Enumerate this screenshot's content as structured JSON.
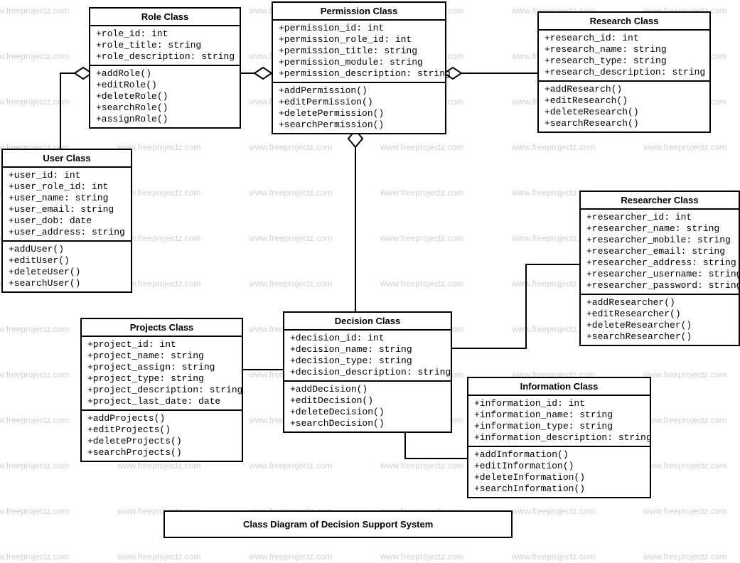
{
  "diagram_title": "Class Diagram of Decision Support System",
  "watermark_text": "www.freeprojectz.com",
  "classes": {
    "role": {
      "name": "Role Class",
      "attrs": [
        "+role_id: int",
        "+role_title: string",
        "+role_description: string"
      ],
      "ops": [
        "+addRole()",
        "+editRole()",
        "+deleteRole()",
        "+searchRole()",
        "+assignRole()"
      ]
    },
    "permission": {
      "name": "Permission Class",
      "attrs": [
        "+permission_id: int",
        "+permission_role_id: int",
        "+permission_title: string",
        "+permission_module: string",
        "+permission_description: string"
      ],
      "ops": [
        "+addPermission()",
        "+editPermission()",
        "+deletePermission()",
        "+searchPermission()"
      ]
    },
    "research": {
      "name": "Research Class",
      "attrs": [
        "+research_id: int",
        "+research_name: string",
        "+research_type: string",
        "+research_description: string"
      ],
      "ops": [
        "+addResearch()",
        "+editResearch()",
        "+deleteResearch()",
        "+searchResearch()"
      ]
    },
    "user": {
      "name": "User Class",
      "attrs": [
        "+user_id: int",
        "+user_role_id: int",
        "+user_name: string",
        "+user_email: string",
        "+user_dob: date",
        "+user_address: string"
      ],
      "ops": [
        "+addUser()",
        "+editUser()",
        "+deleteUser()",
        "+searchUser()"
      ]
    },
    "researcher": {
      "name": "Researcher Class",
      "attrs": [
        "+researcher_id: int",
        "+researcher_name: string",
        "+researcher_mobile: string",
        "+researcher_email: string",
        "+researcher_address: string",
        "+researcher_username: string",
        "+researcher_password: string"
      ],
      "ops": [
        "+addResearcher()",
        "+editResearcher()",
        "+deleteResearcher()",
        "+searchResearcher()"
      ]
    },
    "projects": {
      "name": "Projects Class",
      "attrs": [
        "+project_id: int",
        "+project_name: string",
        "+project_assign: string",
        "+project_type: string",
        "+project_description: string",
        "+project_last_date: date"
      ],
      "ops": [
        "+addProjects()",
        "+editProjects()",
        "+deleteProjects()",
        "+searchProjects()"
      ]
    },
    "decision": {
      "name": "Decision Class",
      "attrs": [
        "+decision_id: int",
        "+decision_name: string",
        "+decision_type: string",
        "+decision_description: string"
      ],
      "ops": [
        "+addDecision()",
        "+editDecision()",
        "+deleteDecision()",
        "+searchDecision()"
      ]
    },
    "information": {
      "name": "Information Class",
      "attrs": [
        "+information_id: int",
        "+information_name: string",
        "+information_type: string",
        "+information_description: string"
      ],
      "ops": [
        "+addInformation()",
        "+editInformation()",
        "+deleteInformation()",
        "+searchInformation()"
      ]
    }
  },
  "chart_data": {
    "type": "table",
    "title": "UML Class Diagram of Decision Support System",
    "classes": [
      {
        "name": "Role Class",
        "attributes": [
          "role_id:int",
          "role_title:string",
          "role_description:string"
        ],
        "operations": [
          "addRole",
          "editRole",
          "deleteRole",
          "searchRole",
          "assignRole"
        ]
      },
      {
        "name": "Permission Class",
        "attributes": [
          "permission_id:int",
          "permission_role_id:int",
          "permission_title:string",
          "permission_module:string",
          "permission_description:string"
        ],
        "operations": [
          "addPermission",
          "editPermission",
          "deletePermission",
          "searchPermission"
        ]
      },
      {
        "name": "Research Class",
        "attributes": [
          "research_id:int",
          "research_name:string",
          "research_type:string",
          "research_description:string"
        ],
        "operations": [
          "addResearch",
          "editResearch",
          "deleteResearch",
          "searchResearch"
        ]
      },
      {
        "name": "User Class",
        "attributes": [
          "user_id:int",
          "user_role_id:int",
          "user_name:string",
          "user_email:string",
          "user_dob:date",
          "user_address:string"
        ],
        "operations": [
          "addUser",
          "editUser",
          "deleteUser",
          "searchUser"
        ]
      },
      {
        "name": "Researcher Class",
        "attributes": [
          "researcher_id:int",
          "researcher_name:string",
          "researcher_mobile:string",
          "researcher_email:string",
          "researcher_address:string",
          "researcher_username:string",
          "researcher_password:string"
        ],
        "operations": [
          "addResearcher",
          "editResearcher",
          "deleteResearcher",
          "searchResearcher"
        ]
      },
      {
        "name": "Projects Class",
        "attributes": [
          "project_id:int",
          "project_name:string",
          "project_assign:string",
          "project_type:string",
          "project_description:string",
          "project_last_date:date"
        ],
        "operations": [
          "addProjects",
          "editProjects",
          "deleteProjects",
          "searchProjects"
        ]
      },
      {
        "name": "Decision Class",
        "attributes": [
          "decision_id:int",
          "decision_name:string",
          "decision_type:string",
          "decision_description:string"
        ],
        "operations": [
          "addDecision",
          "editDecision",
          "deleteDecision",
          "searchDecision"
        ]
      },
      {
        "name": "Information Class",
        "attributes": [
          "information_id:int",
          "information_name:string",
          "information_type:string",
          "information_description:string"
        ],
        "operations": [
          "addInformation",
          "editInformation",
          "deleteInformation",
          "searchInformation"
        ]
      }
    ],
    "relationships": [
      {
        "from": "Role Class",
        "to": "User Class",
        "type": "aggregation",
        "diamond_at": "Role"
      },
      {
        "from": "Permission Class",
        "to": "Role Class",
        "type": "aggregation",
        "diamond_at": "Permission"
      },
      {
        "from": "Permission Class",
        "to": "Research Class",
        "type": "aggregation",
        "diamond_at": "Permission"
      },
      {
        "from": "Permission Class",
        "to": "Decision Class",
        "type": "aggregation",
        "diamond_at": "Permission"
      },
      {
        "from": "Decision Class",
        "to": "Projects Class",
        "type": "association"
      },
      {
        "from": "Decision Class",
        "to": "Researcher Class",
        "type": "association"
      },
      {
        "from": "Decision Class",
        "to": "Information Class",
        "type": "association"
      }
    ]
  }
}
